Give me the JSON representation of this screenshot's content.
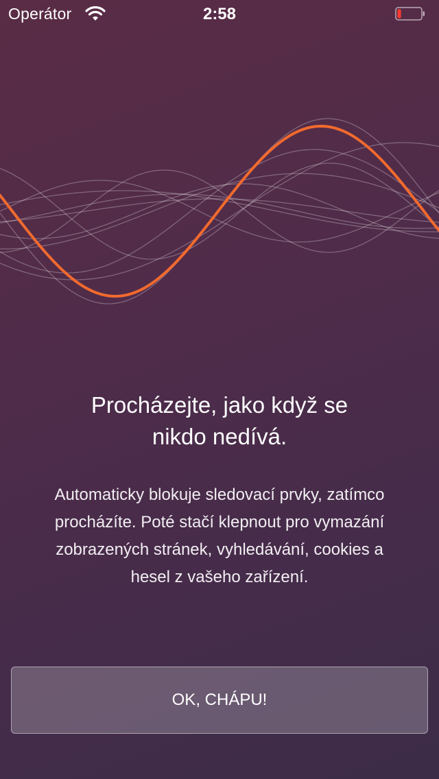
{
  "status_bar": {
    "carrier": "Operátor",
    "time": "2:58",
    "wifi_icon": "wifi-icon",
    "battery_icon": "battery-low-icon",
    "battery_level": 0.15,
    "battery_color": "#ff3b30"
  },
  "illustration": {
    "name": "sound-waves-illustration",
    "accent_color": "#f26a2e"
  },
  "onboarding": {
    "headline_line1": "Procházejte, jako když se",
    "headline_line2": "nikdo nedívá.",
    "body_line1": "Automaticky blokuje sledovací prvky, zatímco",
    "body_line2": "procházíte. Poté stačí klepnout pro vymazání",
    "body_line3": "zobrazených stránek, vyhledávání, cookies a",
    "body_line4": "hesel z vašeho zařízení.",
    "button_label": "OK, CHÁPU!"
  }
}
